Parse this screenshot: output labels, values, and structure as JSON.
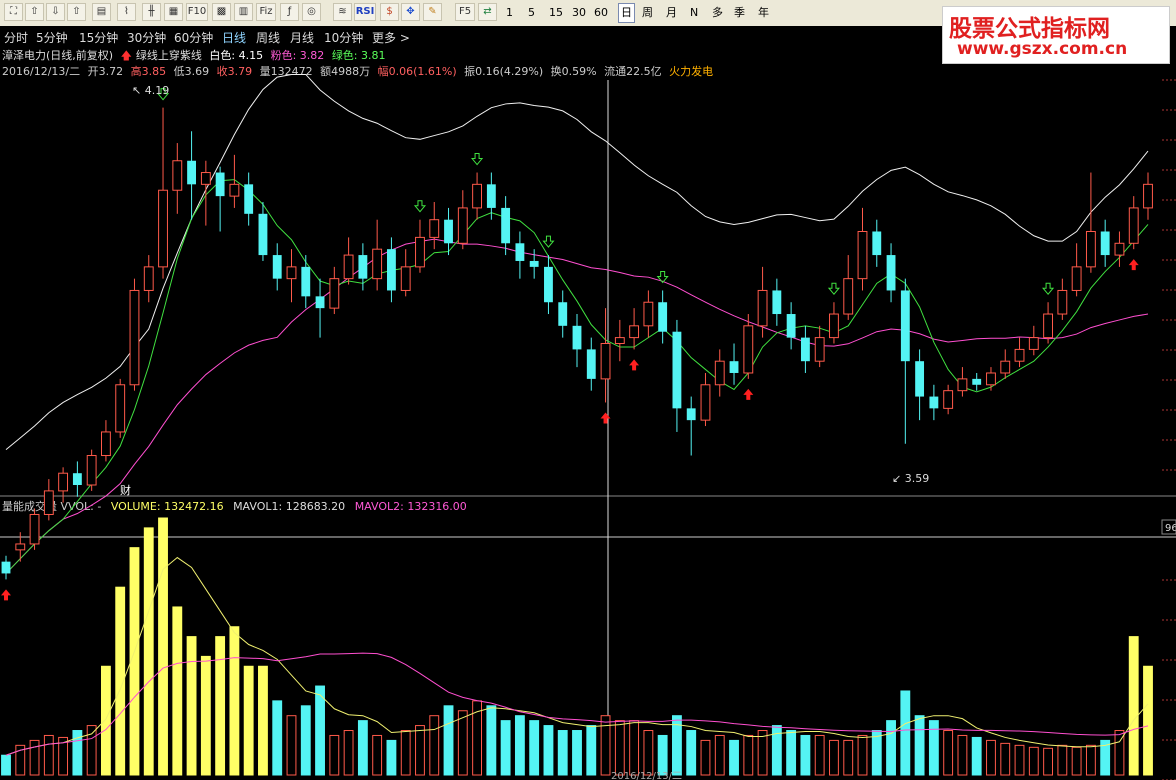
{
  "toolbar": {
    "icons": [
      "fullscreen-icon",
      "back-icon",
      "up-icon",
      "down-icon",
      "list-icon",
      "chart-icon",
      "kline-icon",
      "table-icon",
      "f10-icon",
      "grid-icon",
      "fiz-icon",
      "f10-2-icon",
      "refresh-icon",
      "indicator-icon",
      "rsi-icon",
      "money-icon",
      "move-icon",
      "pen-icon",
      "f5-icon",
      "switch-icon"
    ],
    "labels": {
      "f10": "F10",
      "fiz": "Fiz",
      "rsi": "RSI",
      "f5": "F5"
    },
    "minutes": [
      "1",
      "5",
      "15",
      "30",
      "60"
    ],
    "periods": [
      "日",
      "周",
      "月",
      "N",
      "多",
      "季",
      "年"
    ],
    "active_period": "日"
  },
  "period_bar": {
    "items": [
      "分时",
      "5分钟",
      "15分钟",
      "30分钟",
      "60分钟",
      "日线",
      "周线",
      "月线",
      "10分钟",
      "更多 >"
    ],
    "active": "日线"
  },
  "brand": {
    "title": "股票公式指标网",
    "url": "www.gszx.com.cn"
  },
  "info_line1": {
    "stock": "漳泽电力(日线,前复权)",
    "indicator": "绿线上穿紫线",
    "white_label": "白色: 4.15",
    "pink_label": "粉色: 3.82",
    "green_label": "绿色: 3.81",
    "colors": {
      "white": "#ffffff",
      "pink": "#ff5ad6",
      "green": "#5aff5a",
      "red": "#ff3030"
    }
  },
  "info_line2": {
    "date": "2016/12/13/二",
    "open": "开3.72",
    "high": "高3.85",
    "low": "低3.69",
    "close": "收3.79",
    "volume": "量132472",
    "amount": "额4988万",
    "range": "幅0.06(1.61%)",
    "amplitude": "振0.16(4.29%)",
    "turnover": "换0.59%",
    "float": "流通22.5亿",
    "sector": "火力发电"
  },
  "price_annotations": {
    "high": "4.19",
    "low": "3.59",
    "event": "财"
  },
  "volume_panel": {
    "title": "量能成交量 VVOL: -",
    "volume": "VOLUME: 132472.16",
    "mavol1": "MAVOL1: 128683.20",
    "mavol2": "MAVOL2: 132316.00",
    "scale": "96",
    "colors": {
      "volume": "#ffff66",
      "mavol1": "#dddddd",
      "mavol2": "#ff5ad6"
    }
  },
  "date_axis": {
    "labels": [
      "2016/12/13/二"
    ]
  },
  "candles": [
    [
      3.42,
      3.4,
      3.43,
      3.39
    ],
    [
      3.44,
      3.45,
      3.47,
      3.42
    ],
    [
      3.45,
      3.5,
      3.51,
      3.44
    ],
    [
      3.5,
      3.54,
      3.56,
      3.49
    ],
    [
      3.54,
      3.57,
      3.58,
      3.52
    ],
    [
      3.57,
      3.55,
      3.59,
      3.53
    ],
    [
      3.55,
      3.6,
      3.61,
      3.54
    ],
    [
      3.6,
      3.64,
      3.66,
      3.59
    ],
    [
      3.64,
      3.72,
      3.73,
      3.63
    ],
    [
      3.72,
      3.88,
      3.9,
      3.71
    ],
    [
      3.88,
      3.92,
      3.94,
      3.86
    ],
    [
      3.92,
      4.05,
      4.19,
      3.9
    ],
    [
      4.05,
      4.1,
      4.13,
      4.01
    ],
    [
      4.1,
      4.06,
      4.15,
      4.0
    ],
    [
      4.06,
      4.08,
      4.1,
      3.99
    ],
    [
      4.08,
      4.04,
      4.09,
      3.98
    ],
    [
      4.04,
      4.06,
      4.11,
      4.02
    ],
    [
      4.06,
      4.01,
      4.08,
      3.99
    ],
    [
      4.01,
      3.94,
      4.03,
      3.93
    ],
    [
      3.94,
      3.9,
      3.96,
      3.88
    ],
    [
      3.9,
      3.92,
      3.95,
      3.86
    ],
    [
      3.92,
      3.87,
      3.94,
      3.85
    ],
    [
      3.87,
      3.85,
      3.9,
      3.8
    ],
    [
      3.85,
      3.9,
      3.92,
      3.84
    ],
    [
      3.9,
      3.94,
      3.97,
      3.89
    ],
    [
      3.94,
      3.9,
      3.96,
      3.88
    ],
    [
      3.9,
      3.95,
      4.0,
      3.88
    ],
    [
      3.95,
      3.88,
      3.97,
      3.86
    ],
    [
      3.88,
      3.92,
      3.95,
      3.87
    ],
    [
      3.92,
      3.97,
      4.0,
      3.91
    ],
    [
      3.97,
      4.0,
      4.03,
      3.95
    ],
    [
      4.0,
      3.96,
      4.02,
      3.94
    ],
    [
      3.96,
      4.02,
      4.05,
      3.95
    ],
    [
      4.02,
      4.06,
      4.08,
      4.0
    ],
    [
      4.06,
      4.02,
      4.08,
      4.0
    ],
    [
      4.02,
      3.96,
      4.04,
      3.94
    ],
    [
      3.96,
      3.93,
      3.98,
      3.9
    ],
    [
      3.93,
      3.92,
      3.95,
      3.9
    ],
    [
      3.92,
      3.86,
      3.94,
      3.84
    ],
    [
      3.86,
      3.82,
      3.88,
      3.8
    ],
    [
      3.82,
      3.78,
      3.84,
      3.75
    ],
    [
      3.78,
      3.73,
      3.8,
      3.71
    ],
    [
      3.73,
      3.79,
      3.85,
      3.69
    ],
    [
      3.79,
      3.8,
      3.83,
      3.76
    ],
    [
      3.8,
      3.82,
      3.85,
      3.78
    ],
    [
      3.82,
      3.86,
      3.88,
      3.8
    ],
    [
      3.86,
      3.81,
      3.88,
      3.79
    ],
    [
      3.81,
      3.68,
      3.83,
      3.64
    ],
    [
      3.68,
      3.66,
      3.7,
      3.6
    ],
    [
      3.66,
      3.72,
      3.74,
      3.65
    ],
    [
      3.72,
      3.76,
      3.78,
      3.7
    ],
    [
      3.76,
      3.74,
      3.79,
      3.72
    ],
    [
      3.74,
      3.82,
      3.84,
      3.73
    ],
    [
      3.82,
      3.88,
      3.92,
      3.8
    ],
    [
      3.88,
      3.84,
      3.9,
      3.82
    ],
    [
      3.84,
      3.8,
      3.86,
      3.78
    ],
    [
      3.8,
      3.76,
      3.82,
      3.74
    ],
    [
      3.76,
      3.8,
      3.82,
      3.75
    ],
    [
      3.8,
      3.84,
      3.86,
      3.79
    ],
    [
      3.84,
      3.9,
      3.94,
      3.83
    ],
    [
      3.9,
      3.98,
      4.02,
      3.88
    ],
    [
      3.98,
      3.94,
      4.0,
      3.92
    ],
    [
      3.94,
      3.88,
      3.96,
      3.86
    ],
    [
      3.88,
      3.76,
      3.9,
      3.62
    ],
    [
      3.76,
      3.7,
      3.78,
      3.66
    ],
    [
      3.7,
      3.68,
      3.72,
      3.66
    ],
    [
      3.68,
      3.71,
      3.72,
      3.67
    ],
    [
      3.71,
      3.73,
      3.75,
      3.7
    ],
    [
      3.73,
      3.72,
      3.74,
      3.71
    ],
    [
      3.72,
      3.74,
      3.75,
      3.71
    ],
    [
      3.74,
      3.76,
      3.78,
      3.73
    ],
    [
      3.76,
      3.78,
      3.8,
      3.75
    ],
    [
      3.78,
      3.8,
      3.82,
      3.77
    ],
    [
      3.8,
      3.84,
      3.86,
      3.79
    ],
    [
      3.84,
      3.88,
      3.9,
      3.83
    ],
    [
      3.88,
      3.92,
      3.96,
      3.87
    ],
    [
      3.92,
      3.98,
      4.08,
      3.91
    ],
    [
      3.98,
      3.94,
      4.0,
      3.92
    ],
    [
      3.94,
      3.96,
      3.98,
      3.92
    ],
    [
      3.96,
      4.02,
      4.04,
      3.95
    ],
    [
      4.02,
      4.06,
      4.08,
      4.0
    ]
  ],
  "volumes": [
    20,
    30,
    35,
    40,
    38,
    45,
    50,
    110,
    190,
    230,
    250,
    260,
    170,
    140,
    120,
    140,
    150,
    110,
    110,
    75,
    60,
    70,
    90,
    40,
    45,
    55,
    40,
    35,
    45,
    50,
    60,
    70,
    65,
    75,
    70,
    55,
    60,
    55,
    50,
    45,
    45,
    50,
    60,
    55,
    55,
    45,
    40,
    60,
    45,
    35,
    40,
    35,
    40,
    45,
    50,
    45,
    40,
    40,
    35,
    35,
    40,
    45,
    55,
    85,
    60,
    55,
    45,
    40,
    38,
    35,
    32,
    30,
    28,
    27,
    30,
    28,
    30,
    35,
    45,
    140,
    110,
    80,
    70,
    120,
    115,
    110,
    95
  ]
}
